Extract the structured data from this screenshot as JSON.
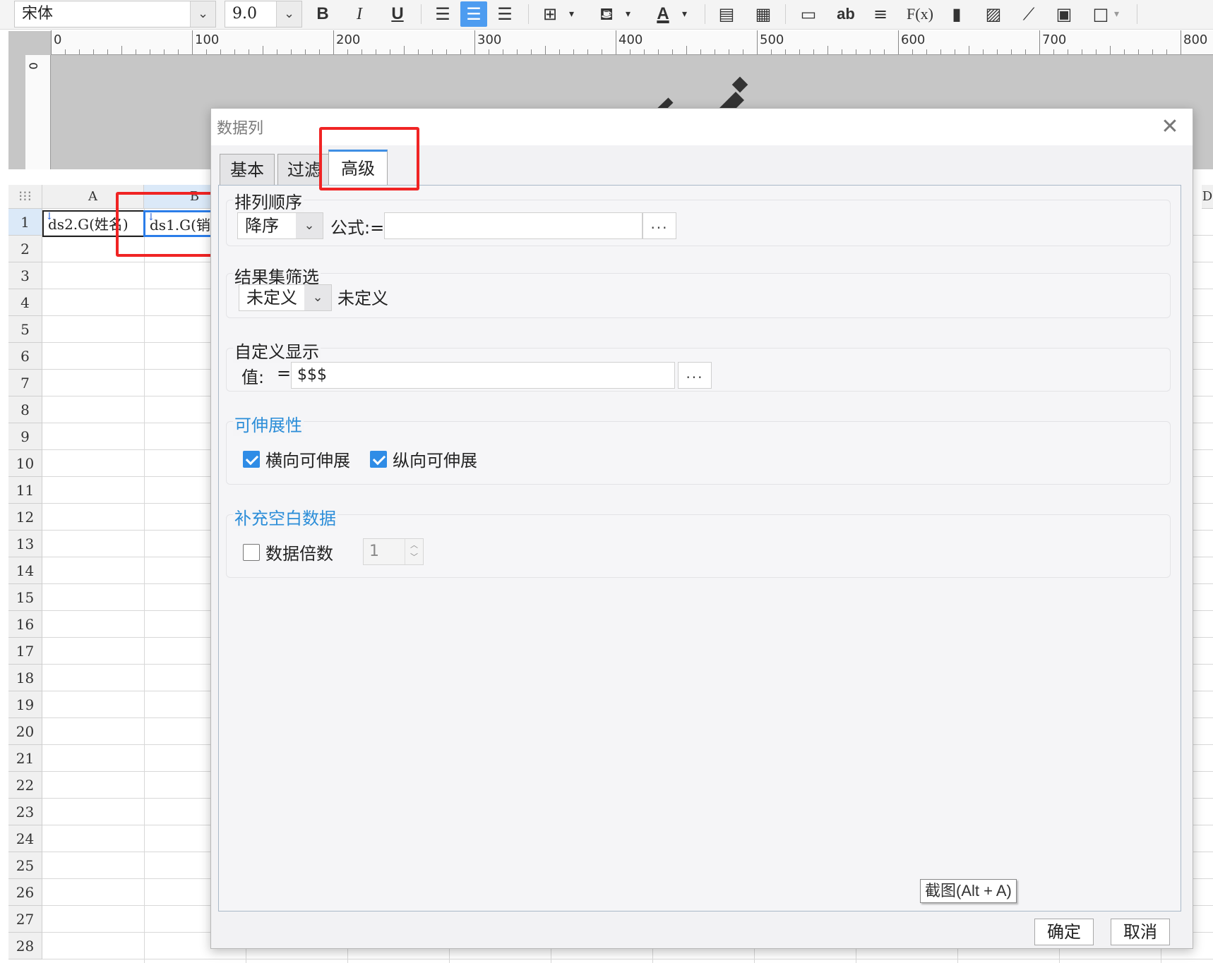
{
  "toolbar": {
    "font_name": "宋体",
    "font_size": "9.0",
    "bold": "B",
    "italic": "I",
    "underline": "U",
    "text_tool": "ab",
    "formula_tool": "F(x)"
  },
  "ruler": {
    "top_labels": [
      "0",
      "100",
      "200",
      "300",
      "400",
      "500",
      "600",
      "700",
      "800"
    ],
    "left_label": "0"
  },
  "sheet": {
    "columns": [
      "A",
      "B"
    ],
    "next_column_partial": "D",
    "rows": [
      "1",
      "2",
      "3",
      "4",
      "5",
      "6",
      "7",
      "8",
      "9",
      "10",
      "11",
      "12",
      "13",
      "14",
      "15",
      "16",
      "17",
      "18",
      "19",
      "20",
      "21",
      "22",
      "23",
      "24",
      "25",
      "26",
      "27",
      "28"
    ],
    "cell_a1": "ds2.G(姓名)",
    "cell_b1": "ds1.G(销"
  },
  "dialog": {
    "title": "数据列",
    "tabs": [
      "基本",
      "过滤",
      "高级"
    ],
    "active_tab": "高级",
    "sort": {
      "title": "排列顺序",
      "order_value": "降序",
      "formula_label": "公式:=",
      "formula_value": "",
      "more_button": "..."
    },
    "result_filter": {
      "title": "结果集筛选",
      "select_value": "未定义",
      "value_text": "未定义"
    },
    "custom_display": {
      "title": "自定义显示",
      "value_label": "值:",
      "equals": "=",
      "value": "$$$",
      "more_button": "..."
    },
    "expand": {
      "title": "可伸展性",
      "horizontal_label": "横向可伸展",
      "horizontal_checked": true,
      "vertical_label": "纵向可伸展",
      "vertical_checked": true
    },
    "fill_blank": {
      "title": "补充空白数据",
      "multiple_label": "数据倍数",
      "multiple_checked": false,
      "multiple_value": "1"
    },
    "tooltip": "截图(Alt + A)",
    "ok_button": "确定",
    "cancel_button": "取消"
  },
  "colors": {
    "accent_blue": "#2f8ce6",
    "highlight_red": "#f02424",
    "section_title_blue": "#2b8dd8"
  }
}
